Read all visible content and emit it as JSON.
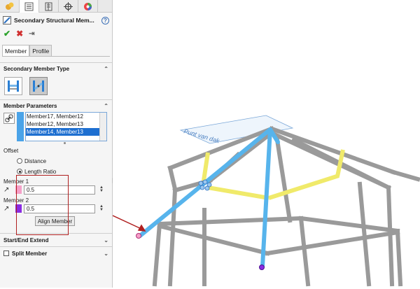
{
  "panel": {
    "tabs": [
      {
        "icon": "feature-manager-icon"
      },
      {
        "icon": "property-manager-icon"
      },
      {
        "icon": "configuration-manager-icon"
      },
      {
        "icon": "dimxpert-icon"
      },
      {
        "icon": "display-manager-icon"
      }
    ],
    "title": "Secondary Structural Mem...",
    "help": "?",
    "sub_tabs": [
      "Member",
      "Profile"
    ],
    "member_type": {
      "heading": "Secondary Member Type"
    },
    "parameters": {
      "heading": "Member Parameters",
      "list": [
        "Member17, Member12",
        "Member12, Member13",
        "Member14, Member13"
      ],
      "selected_index": 2
    },
    "offset": {
      "label": "Offset",
      "options": [
        "Distance",
        "Length Ratio"
      ],
      "selected": "Length Ratio"
    },
    "member1": {
      "label": "Member 1",
      "value": "0.5",
      "color": "#f5a0c8"
    },
    "member2": {
      "label": "Member 2",
      "value": "0.5",
      "color": "#8a2be2"
    },
    "align_button": "Align Member",
    "start_end": "Start/End Extend",
    "split": "Split Member"
  },
  "viewport": {
    "plane_label": "Punt van dak",
    "colors": {
      "steel": "#9a9a9a",
      "blue_member": "#57b4ec",
      "yellow_member": "#f0ea6a",
      "red_arrow": "#b02020"
    }
  }
}
